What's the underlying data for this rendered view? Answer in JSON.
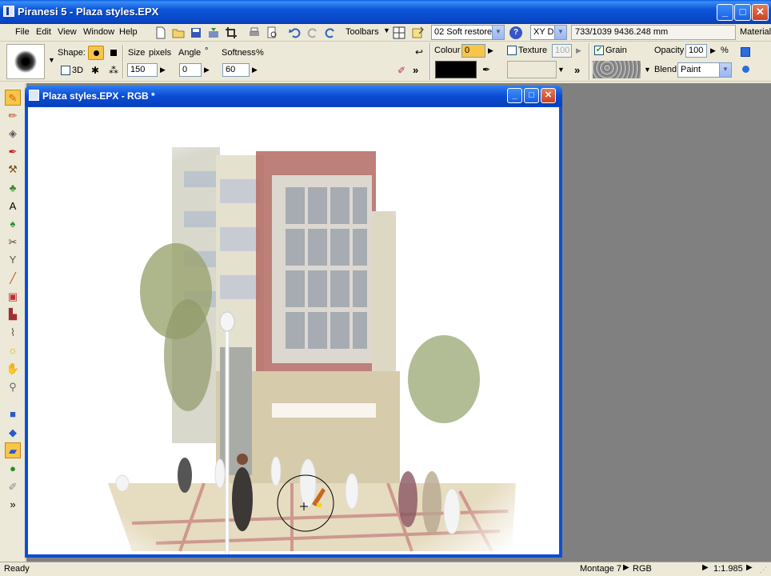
{
  "app": {
    "title": "Piranesi 5 - Plaza styles.EPX",
    "window_controls": {
      "minimize": "_",
      "maximize": "□",
      "close": "✕"
    }
  },
  "menu": [
    "File",
    "Edit",
    "View",
    "Window",
    "Help"
  ],
  "toolbar": {
    "toolbars_label": "Toolbars",
    "style_value": "02 Soft restore",
    "view_mode": "XY D",
    "coords_readout": "733/1039 9436.248 mm",
    "material_label": "Material"
  },
  "options": {
    "shape_label": "Shape:",
    "threed_label": "3D",
    "size_label": "Size",
    "pixels_label": "pixels",
    "size_value": "150",
    "angle_label": "Angle",
    "angle_unit": "°",
    "angle_value": "0",
    "softness_label": "Softness",
    "softness_unit": "%",
    "softness_value": "60",
    "colour_label": "Colour",
    "colour_value": "0",
    "colour_swatch": "#000000",
    "texture_label": "Texture",
    "texture_value": "100",
    "texture_checked": false,
    "grain_label": "Grain",
    "grain_checked": true,
    "opacity_label": "Opacity",
    "opacity_value": "100",
    "opacity_unit": "%",
    "blend_label": "Blend",
    "blend_value": "Paint",
    "more": "»"
  },
  "document": {
    "title": "Plaza styles.EPX - RGB *"
  },
  "left_tools": [
    {
      "name": "brush-tool-icon",
      "glyph": "✎",
      "active": true
    },
    {
      "name": "pencil-tool-icon",
      "glyph": "✏"
    },
    {
      "name": "fill-tool-icon",
      "glyph": "◈"
    },
    {
      "name": "spray-tool-icon",
      "glyph": "✒"
    },
    {
      "name": "stamp-tool-icon",
      "glyph": "⚒"
    },
    {
      "name": "tree-tool-icon",
      "glyph": "♣"
    },
    {
      "name": "text-tool-icon",
      "glyph": "A"
    },
    {
      "name": "forest-tool-icon",
      "glyph": "♠"
    },
    {
      "name": "cutout-tool-icon",
      "glyph": "✂"
    },
    {
      "name": "pick-tool-icon",
      "glyph": "Y"
    },
    {
      "name": "line-tool-icon",
      "glyph": "╱"
    },
    {
      "name": "box-tool-icon",
      "glyph": "▣"
    },
    {
      "name": "building-tool-icon",
      "glyph": "▙"
    },
    {
      "name": "measure-tool-icon",
      "glyph": "⌇"
    },
    {
      "name": "light-tool-icon",
      "glyph": "☼"
    },
    {
      "name": "hand-tool-icon",
      "glyph": "✋"
    },
    {
      "name": "zoom-tool-icon",
      "glyph": "⚲"
    },
    {
      "name": "cube-tool-icon",
      "glyph": "■"
    },
    {
      "name": "cube-rotate-tool-icon",
      "glyph": "◆"
    },
    {
      "name": "cube-active-tool-icon",
      "glyph": "▰",
      "active": true
    },
    {
      "name": "colour-wheel-icon",
      "glyph": "●"
    },
    {
      "name": "eyedropper-tool-icon",
      "glyph": "✐"
    },
    {
      "name": "more-tools-icon",
      "glyph": "»"
    }
  ],
  "status": {
    "ready": "Ready",
    "montage": "Montage 7",
    "mode": "RGB",
    "zoom": "1:1.985"
  }
}
